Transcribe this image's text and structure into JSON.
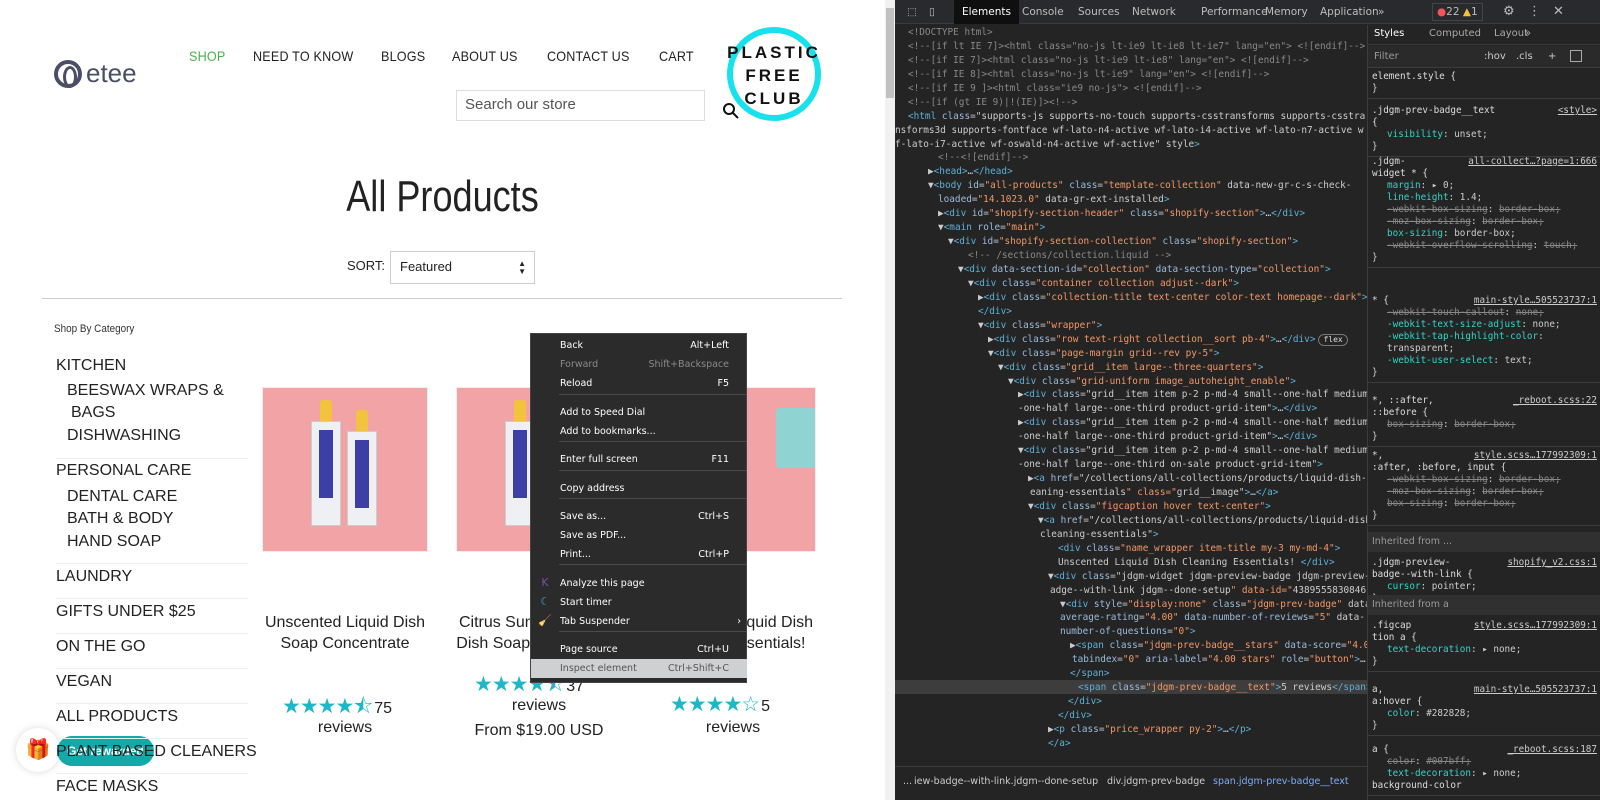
{
  "site": {
    "logo_text": "etee",
    "nav": [
      "SHOP",
      "NEED TO KNOW",
      "BLOGS",
      "ABOUT US",
      "CONTACT US",
      "CART"
    ],
    "search_placeholder": "Search our store",
    "badge_lines": [
      "PLASTIC",
      "FREE",
      "CLUB"
    ],
    "page_title": "All Products",
    "sort_label": "SORT:",
    "sort_value": "Featured",
    "category_heading": "Shop By Category",
    "categories": [
      "KITCHEN",
      "BEESWAX WRAPS &",
      "BAGS",
      "DISHWASHING",
      "PERSONAL CARE",
      "DENTAL CARE",
      "BATH & BODY",
      "HAND SOAP",
      "LAUNDRY",
      "GIFTS UNDER $25",
      "ON THE GO",
      "VEGAN",
      "ALL PRODUCTS",
      "PLANT BASED CLEANERS",
      "FACE MASKS"
    ],
    "products": [
      {
        "name": "Unscented Liquid Dish Soap Concentrate",
        "rating": 4.5,
        "reviews": "75",
        "reviews_label": "reviews",
        "price": ""
      },
      {
        "name": "Citrus Sunshine Liquid Dish Soap Concentrate",
        "rating": 4.5,
        "reviews": "37",
        "reviews_label": "reviews",
        "price": "From $19.00 USD"
      },
      {
        "name": "Unscented Liquid Dish Cleaning Essentials!",
        "rating": 4,
        "reviews": "5",
        "reviews_label": "reviews",
        "price": ""
      }
    ],
    "rewards_label": "Get rewarded",
    "accent": "#4caf50",
    "star_color": "#1bb8c8"
  },
  "context_menu": [
    {
      "label": "Back",
      "shortcut": "Alt+Left"
    },
    {
      "label": "Forward",
      "shortcut": "Shift+Backspace",
      "disabled": true
    },
    {
      "label": "Reload",
      "shortcut": "F5"
    },
    {
      "label": "Add to Speed Dial",
      "shortcut": ""
    },
    {
      "label": "Add to bookmarks...",
      "shortcut": ""
    },
    {
      "label": "Enter full screen",
      "shortcut": "F11"
    },
    {
      "label": "Copy address",
      "shortcut": ""
    },
    {
      "label": "Save as...",
      "shortcut": "Ctrl+S"
    },
    {
      "label": "Save as PDF...",
      "shortcut": ""
    },
    {
      "label": "Print...",
      "shortcut": "Ctrl+P"
    },
    {
      "label": "Analyze this page",
      "shortcut": ""
    },
    {
      "label": "Start timer",
      "shortcut": ""
    },
    {
      "label": "Tab Suspender",
      "shortcut": "›"
    },
    {
      "label": "Page source",
      "shortcut": "Ctrl+U"
    },
    {
      "label": "Inspect element",
      "shortcut": "Ctrl+Shift+C"
    }
  ],
  "devtools": {
    "tabs": [
      "Elements",
      "Console",
      "Sources",
      "Network",
      "Performance",
      "Memory",
      "Application",
      "»"
    ],
    "errors": "22",
    "warnings": "1",
    "flex_badge": "flex",
    "dom_lines": [
      "<!DOCTYPE html>",
      "<!--[if lt IE 7]><html class=\"no-js lt-ie9 lt-ie8 lt-ie7\" lang=\"en\"> <![endif]-->",
      "<!--[if IE 7]><html class=\"no-js lt-ie9 lt-ie8\" lang=\"en\"> <![endif]-->",
      "<!--[if IE 8]><html class=\"no-js lt-ie9\" lang=\"en\"> <![endif]-->",
      "<!--[if IE 9 ]><html class=\"ie9 no-js\"> <![endif]-->",
      "<!--[if (gt IE 9)|!(IE)]><!-->",
      "<html class=\"supports-js supports-no-touch supports-csstransforms supports-csstra",
      "nsforms3d supports-fontface wf-lato-n4-active wf-lato-i4-active wf-lato-n7-active w",
      "f-lato-i7-active wf-oswald-n4-active wf-active\" style>",
      "<!--<![endif]-->",
      "▶<head>…</head>",
      "▼<body id=\"all-products\" class=\"template-collection\" data-new-gr-c-s-check-",
      "loaded=\"14.1023.0\" data-gr-ext-installed>",
      "▶<div id=\"shopify-section-header\" class=\"shopify-section\">…</div>",
      "▼<main role=\"main\">",
      "▼<div id=\"shopify-section-collection\" class=\"shopify-section\">",
      "<!-- /sections/collection.liquid -->",
      "▼<div data-section-id=\"collection\" data-section-type=\"collection\">",
      "▼<div class=\"container collection adjust--dark\">",
      "▶<div class=\"collection-title text-center color-text homepage--dark\">…",
      "</div>",
      "▼<div class=\"wrapper\">",
      "▶<div class=\"row text-right collection__sort pb-4\">…</div>",
      "▼<div class=\"page-margin grid--rev py-5\">",
      "▼<div class=\"grid__item large--three-quarters\">",
      "▼<div class=\"grid-uniform image_autoheight_enable\">",
      "▶<div class=\"grid__item item p-2 p-md-4  small--one-half medium",
      "-one-half large--one-third  product-grid-item\">…</div>",
      "▶<div class=\"grid__item item p-2 p-md-4  small--one-half medium",
      "-one-half large--one-third  product-grid-item\">…</div>",
      "▼<div class=\"grid__item item p-2 p-md-4  small--one-half medium",
      "-one-half large--one-third on-sale  product-grid-item\">",
      "▶<a href=\"/collections/all-collections/products/liquid-dish-cl",
      "eaning-essentials\" class=\"grid__image\">…</a>",
      "▼<div class=\"figcaption hover text-center\">",
      "▼<a href=\"/collections/all-collections/products/liquid-dish-",
      "cleaning-essentials\">",
      "<div class=\"name_wrapper item-title my-3 my-md-4\">",
      "Unscented Liquid Dish Cleaning Essentials! </div>",
      "▼<div class=\"jdgm-widget jdgm-preview-badge jdgm-preview-b",
      "adge--with-link jdgm--done-setup\" data-id=\"4389555830846\">",
      "▼<div style=\"display:none\" class=\"jdgm-prev-badge\" data-",
      "average-rating=\"4.00\" data-number-of-reviews=\"5\" data-",
      "number-of-questions=\"0\">",
      "▶<span class=\"jdgm-prev-badge__stars\" data-score=\"4.00\"",
      "tabindex=\"0\" aria-label=\"4.00 stars\" role=\"button\">…",
      "</span>",
      "<span class=\"jdgm-prev-badge__text\">5 reviews</span> == $0",
      "</div>",
      "</div>",
      "▶<p class=\"price_wrapper py-2\">…</p>",
      "</a>"
    ],
    "breadcrumbs": [
      "...",
      "iew-badge--with-link.jdgm--done-setup",
      "div.jdgm-prev-badge",
      "span.jdgm-prev-badge__text"
    ],
    "styles_tabs": [
      "Styles",
      "Computed",
      "Layout",
      "»"
    ],
    "filter_placeholder": "Filter",
    "filter_buttons": [
      ":hov",
      ".cls",
      "+"
    ],
    "inherited_1": "Inherited from ...",
    "inherited_2": "Inherited from a",
    "rules": [
      {
        "selector": "element.style {",
        "source": "",
        "decls": [],
        "close": "}"
      },
      {
        "selector": ".jdgm-prev-badge__text",
        "source": "<style>",
        "decls": [
          {
            "p": "{",
            "v": ""
          },
          {
            "p": "visibility",
            "v": "unset;"
          }
        ],
        "close": "}"
      },
      {
        "selector": ".jdgm-",
        "source": "all-collect…?page=1:666",
        "decls": [
          {
            "p": "widget * {",
            "v": ""
          },
          {
            "p": "margin",
            "v": "▸ 0;"
          },
          {
            "p": "line-height",
            "v": "1.4;"
          },
          {
            "p": "-webkit-box-sizing",
            "v": "border-box;",
            "s": true
          },
          {
            "p": "-moz-box-sizing",
            "v": "border-box;",
            "s": true
          },
          {
            "p": "box-sizing",
            "v": "border-box;"
          },
          {
            "p": "-webkit-overflow-scrolling",
            "v": "touch;",
            "s": true
          }
        ],
        "close": "}"
      },
      {
        "selector": "* {",
        "source": "main-style…505523737:1",
        "decls": [
          {
            "p": "-webkit-touch-callout",
            "v": "none;",
            "s": true
          },
          {
            "p": "-webkit-text-size-adjust",
            "v": "none;"
          },
          {
            "p": "-webkit-tap-highlight-color",
            "v": "transparent;"
          },
          {
            "p": "-webkit-user-select",
            "v": "text;"
          }
        ],
        "close": "}"
      },
      {
        "selector": "*, ::after,",
        "source": "_reboot.scss:22",
        "decls": [
          {
            "p": "::before {",
            "v": ""
          },
          {
            "p": "box-sizing",
            "v": "border-box;",
            "s": true
          }
        ],
        "close": "}"
      },
      {
        "selector": "*,",
        "source": "style.scss…177992309:1",
        "decls": [
          {
            "p": ":after, :before, input {",
            "v": ""
          },
          {
            "p": "-webkit-box-sizing",
            "v": "border-box;",
            "s": true
          },
          {
            "p": "-moz-box-sizing",
            "v": "border-box;",
            "s": true
          },
          {
            "p": "box-sizing",
            "v": "border-box;",
            "s": true
          }
        ],
        "close": "}"
      },
      {
        "selector": ".jdgm-preview-",
        "source": "shopify_v2.css:1",
        "decls": [
          {
            "p": "badge--with-link {",
            "v": ""
          },
          {
            "p": "cursor",
            "v": "pointer;"
          }
        ],
        "close": "}"
      },
      {
        "selector": ".figcap",
        "source": "style.scss…177992309:1",
        "decls": [
          {
            "p": "tion a {",
            "v": ""
          },
          {
            "p": "text-decoration",
            "v": "▸ none;"
          }
        ],
        "close": "}"
      },
      {
        "selector": "a,",
        "source": "main-style…505523737:1",
        "decls": [
          {
            "p": "a:hover {",
            "v": ""
          },
          {
            "p": "color",
            "v": "#282828;"
          }
        ],
        "close": "}"
      },
      {
        "selector": "a {",
        "source": "_reboot.scss:187",
        "decls": [
          {
            "p": "color",
            "v": "#007bff;",
            "s": true
          },
          {
            "p": "text-decoration",
            "v": "▸ none;"
          },
          {
            "p": "background-color",
            "v": ""
          }
        ],
        "close": ""
      }
    ]
  }
}
